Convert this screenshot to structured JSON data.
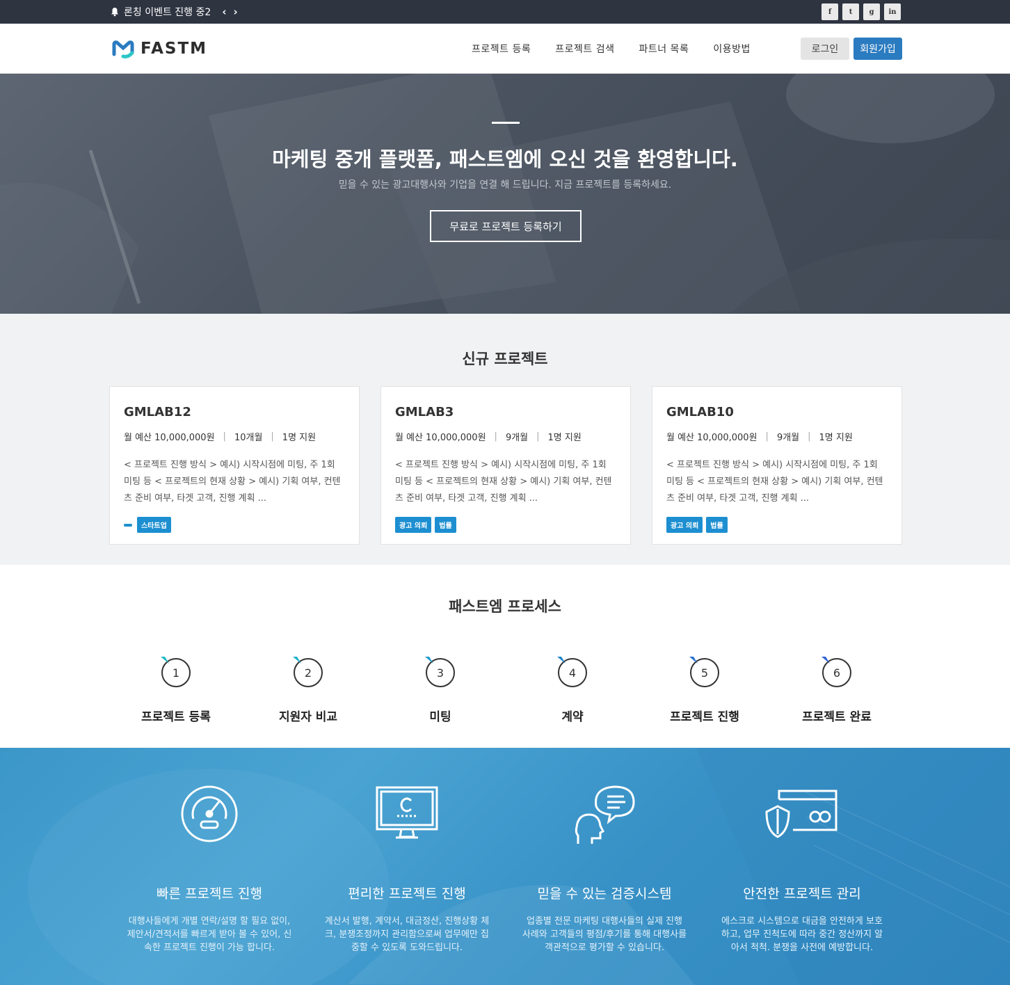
{
  "topbar": {
    "notice": "론칭 이벤트 진행 중2",
    "prev": "‹",
    "next": "›",
    "social": [
      "f",
      "t",
      "g",
      "in"
    ]
  },
  "header": {
    "logo_text": "FASTM",
    "nav": [
      "프로젝트 등록",
      "프로젝트 검색",
      "파트너 목록",
      "이용방법"
    ],
    "login": "로그인",
    "join": "회원가입"
  },
  "hero": {
    "title": "마케팅 중개 플랫폼, 패스트엠에 오신 것을 환영합니다.",
    "subtitle": "믿을 수 있는 광고대행사와 기업을 연결 해 드립니다. 지금 프로젝트를 등록하세요.",
    "cta": "무료로 프로젝트 등록하기"
  },
  "projects": {
    "title": "신규 프로젝트",
    "cards": [
      {
        "name": "GMLAB12",
        "budget": "월 예산 10,000,000원",
        "period": "10개월",
        "applicants": "1명 지원",
        "desc": "< 프로젝트 진행 방식 > 예시) 시작시점에 미팅, 주 1회 미팅 등 < 프로젝트의 현재 상황 > 예시) 기획 여부, 컨텐츠 준비 여부, 타겟 고객, 진행 계획 ...",
        "tags": [
          "스타트업"
        ]
      },
      {
        "name": "GMLAB3",
        "budget": "월 예산 10,000,000원",
        "period": "9개월",
        "applicants": "1명 지원",
        "desc": "< 프로젝트 진행 방식 > 예시) 시작시점에 미팅, 주 1회 미팅 등 < 프로젝트의 현재 상황 > 예시) 기획 여부, 컨텐츠 준비 여부, 타겟 고객, 진행 계획 ...",
        "tags": [
          "광고 의뢰",
          "법률"
        ]
      },
      {
        "name": "GMLAB10",
        "budget": "월 예산 10,000,000원",
        "period": "9개월",
        "applicants": "1명 지원",
        "desc": "< 프로젝트 진행 방식 > 예시) 시작시점에 미팅, 주 1회 미팅 등 < 프로젝트의 현재 상황 > 예시) 기획 여부, 컨텐츠 준비 여부, 타겟 고객, 진행 계획 ...",
        "tags": [
          "광고 의뢰",
          "법률"
        ]
      }
    ]
  },
  "process": {
    "title": "패스트엠 프로세스",
    "steps": [
      {
        "num": "1",
        "label": "프로젝트 등록"
      },
      {
        "num": "2",
        "label": "지원자 비교"
      },
      {
        "num": "3",
        "label": "미팅"
      },
      {
        "num": "4",
        "label": "계약"
      },
      {
        "num": "5",
        "label": "프로젝트 진행"
      },
      {
        "num": "6",
        "label": "프로젝트 완료"
      }
    ]
  },
  "features": [
    {
      "icon": "speedometer-icon",
      "title": "빠른 프로젝트 진행",
      "desc": "대행사들에게 개별 연락/설명 할 필요 없이, 제안서/견적서를 빠르게 받아 볼 수 있어, 신속한 프로젝트 진행이 가능 합니다."
    },
    {
      "icon": "monitor-icon",
      "title": "편리한 프로젝트 진행",
      "desc": "계산서 발행, 계약서, 대금정산, 진행상황 체크, 분쟁조정까지 관리함으로써 업무에만 집중할 수 있도록 도와드립니다."
    },
    {
      "icon": "chat-person-icon",
      "title": "믿을 수 있는 검증시스템",
      "desc": "업종별 전문 마케팅 대행사들의 실제 진행 사례와 고객들의 평점/후기를 통해 대행사를 객관적으로 평가할 수 있습니다."
    },
    {
      "icon": "shield-card-icon",
      "title": "안전한 프로젝트 관리",
      "desc": "에스크로 시스템으로 대금을 안전하게 보호하고, 업무 진척도에 따라 중간 정산까지 알아서 척척. 분쟁을 사전에 예방합니다."
    }
  ],
  "colors": {
    "topbar": "#2e3440",
    "primary": "#2b7bc0",
    "tag": "#1d8fd1",
    "features_bg": "#3891c6"
  }
}
